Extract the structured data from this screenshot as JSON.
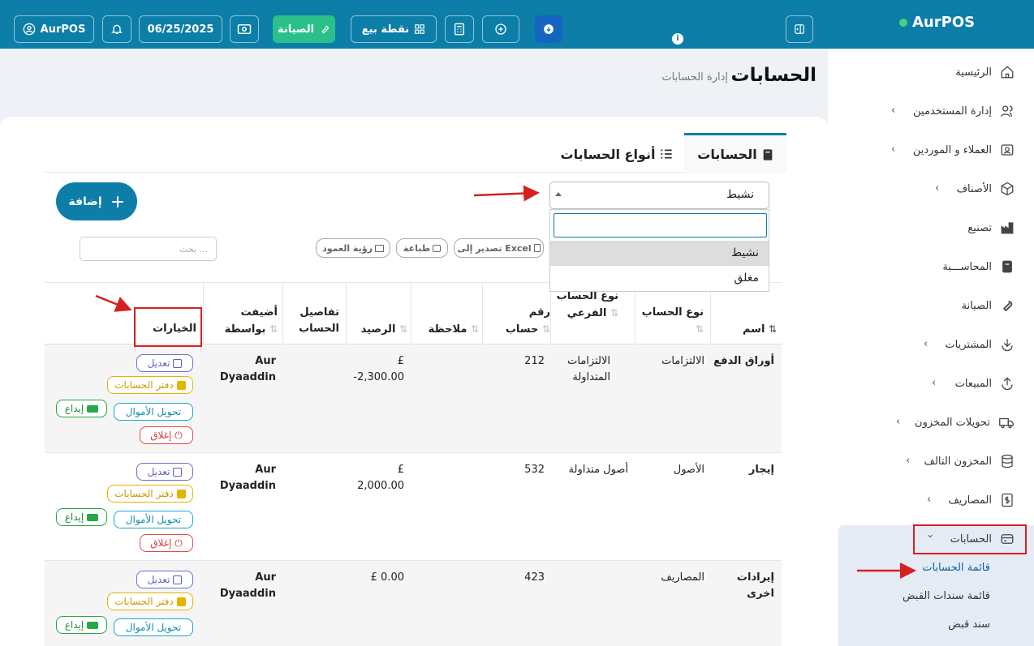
{
  "topbar": {
    "user_label": "AurPOS",
    "date": "06/25/2025",
    "maintenance_label": "الصيانة",
    "pos_label": "نقطة بيع"
  },
  "brand": {
    "name": "AurPOS"
  },
  "sidebar": {
    "items": [
      {
        "label": "الرئيسية"
      },
      {
        "label": "إدارة المستخدمين"
      },
      {
        "label": "العملاء و الموردين"
      },
      {
        "label": "الأصناف"
      },
      {
        "label": "تصنيع"
      },
      {
        "label": "المحاســـبة"
      },
      {
        "label": "الصيانة"
      },
      {
        "label": "المشتريات"
      },
      {
        "label": "المبيعات"
      },
      {
        "label": "تحويلات المخزون"
      },
      {
        "label": "المخزون التالف"
      },
      {
        "label": "المصاريف"
      },
      {
        "label": "الحسابات"
      }
    ],
    "subitems": [
      {
        "label": "قائمة الحسابات"
      },
      {
        "label": "قائمة سندات القبض"
      },
      {
        "label": "سند قبض"
      }
    ]
  },
  "header": {
    "title": "الحسابات",
    "subtitle": "إدارة الحسابات"
  },
  "tabs": [
    {
      "label": "الحسابات"
    },
    {
      "label": "أنواع الحسابات"
    }
  ],
  "add_label": "إضافة",
  "status_select": {
    "value": "نشيط",
    "options": [
      "نشيط",
      "مغلق"
    ]
  },
  "toolbar": {
    "export": "تصدير إلى Excel",
    "print": "طباعة",
    "columns": "رؤية العمود",
    "search_placeholder": "بحث ..."
  },
  "table": {
    "headers": [
      "اسم",
      "نوع الحساب",
      "نوع الحساب الفرعي",
      "رقم حساب",
      "ملاحظة",
      "الرصيد",
      "تفاصيل الحساب",
      "أضيفت بواسطة",
      "الخيارات"
    ],
    "rows": [
      {
        "name": "أوراق الدفع",
        "type": "الالتزامات",
        "subtype": "الالتزامات المتداولة",
        "number": "212",
        "note": "",
        "balance_cur": "£",
        "balance": "-2,300.00",
        "details": "",
        "added_by": "Aur Dyaaddin"
      },
      {
        "name": "إيجار",
        "type": "الأصول",
        "subtype": "أصول متداولة",
        "number": "532",
        "note": "",
        "balance_cur": "£",
        "balance": "2,000.00",
        "details": "",
        "added_by": "Aur Dyaaddin"
      },
      {
        "name": "إيرادات اخرى",
        "type": "المصاريف",
        "subtype": "",
        "number": "423",
        "note": "",
        "balance_cur": "£",
        "balance": "0.00",
        "details": "",
        "added_by": "Aur Dyaaddin"
      }
    ],
    "actions": {
      "edit": "تعديل",
      "ledger": "دفتر الحسابات",
      "transfer": "تحويل الأموال",
      "deposit": "إيداع",
      "close": "إغلاق"
    }
  },
  "colors": {
    "primary": "#0c7ea8",
    "annotation": "#d62020"
  }
}
